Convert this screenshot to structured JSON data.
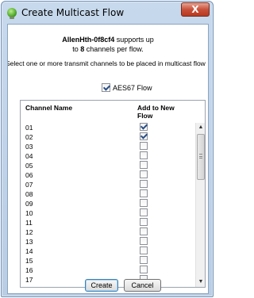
{
  "window": {
    "title": "Create Multicast Flow",
    "close_glyph": "X",
    "icon": "green-globe-icon"
  },
  "info": {
    "device_name": "AllenHth-0f8cf4",
    "line1_suffix": " supports up",
    "line2_prefix": "to ",
    "max_channels": "8",
    "line2_suffix": " channels per flow."
  },
  "instruction": "Select one or more transmit channels to be placed in multicast flow",
  "aes67": {
    "label": "AES67 Flow",
    "checked": true
  },
  "table": {
    "header_channel": "Channel Name",
    "header_add": "Add to New Flow",
    "rows": [
      {
        "channel": "01",
        "checked": true
      },
      {
        "channel": "02",
        "checked": true
      },
      {
        "channel": "03",
        "checked": false
      },
      {
        "channel": "04",
        "checked": false
      },
      {
        "channel": "05",
        "checked": false
      },
      {
        "channel": "06",
        "checked": false
      },
      {
        "channel": "07",
        "checked": false
      },
      {
        "channel": "08",
        "checked": false
      },
      {
        "channel": "09",
        "checked": false
      },
      {
        "channel": "10",
        "checked": false
      },
      {
        "channel": "11",
        "checked": false
      },
      {
        "channel": "12",
        "checked": false
      },
      {
        "channel": "13",
        "checked": false
      },
      {
        "channel": "14",
        "checked": false
      },
      {
        "channel": "15",
        "checked": false
      },
      {
        "channel": "16",
        "checked": false
      },
      {
        "channel": "17",
        "checked": false
      }
    ]
  },
  "buttons": {
    "create": "Create",
    "cancel": "Cancel"
  },
  "colors": {
    "accent": "#3c7fb1",
    "frame": "#c7d9ec",
    "close": "#c9503a"
  }
}
